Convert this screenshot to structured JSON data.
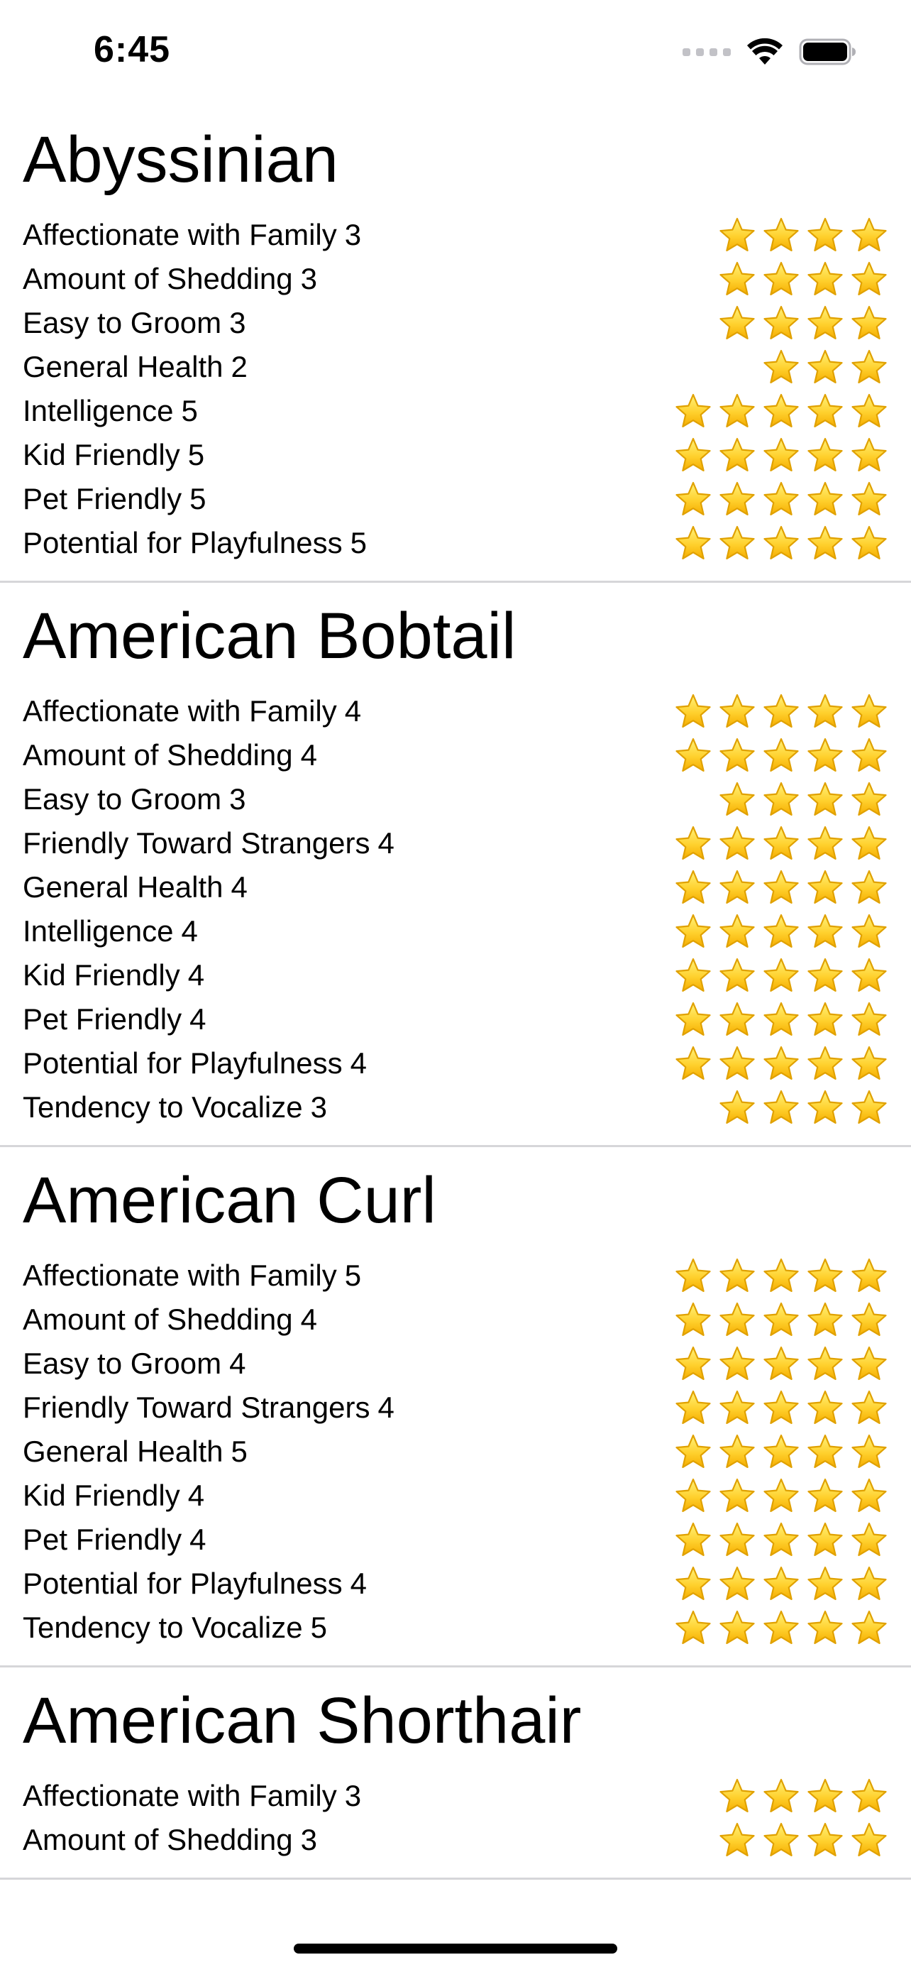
{
  "status_bar": {
    "time": "6:45"
  },
  "colors": {
    "star_fill": "#ffd12e",
    "star_stroke": "#e0a100",
    "separator": "#d6d6d9"
  },
  "icons": {
    "star": "star-icon",
    "wifi": "wifi-icon",
    "battery": "battery-icon",
    "signal": "signal-icon"
  },
  "breeds": [
    {
      "name": "Abyssinian",
      "ratings": [
        {
          "label": "Affectionate with Family",
          "value": 3,
          "stars": 4
        },
        {
          "label": "Amount of Shedding",
          "value": 3,
          "stars": 4
        },
        {
          "label": "Easy to Groom",
          "value": 3,
          "stars": 4
        },
        {
          "label": "General Health",
          "value": 2,
          "stars": 3
        },
        {
          "label": "Intelligence",
          "value": 5,
          "stars": 5
        },
        {
          "label": "Kid Friendly",
          "value": 5,
          "stars": 5
        },
        {
          "label": "Pet Friendly",
          "value": 5,
          "stars": 5
        },
        {
          "label": "Potential for Playfulness",
          "value": 5,
          "stars": 5
        }
      ]
    },
    {
      "name": "American Bobtail",
      "ratings": [
        {
          "label": "Affectionate with Family",
          "value": 4,
          "stars": 5
        },
        {
          "label": "Amount of Shedding",
          "value": 4,
          "stars": 5
        },
        {
          "label": "Easy to Groom",
          "value": 3,
          "stars": 4
        },
        {
          "label": "Friendly Toward Strangers",
          "value": 4,
          "stars": 5
        },
        {
          "label": "General Health",
          "value": 4,
          "stars": 5
        },
        {
          "label": "Intelligence",
          "value": 4,
          "stars": 5
        },
        {
          "label": "Kid Friendly",
          "value": 4,
          "stars": 5
        },
        {
          "label": "Pet Friendly",
          "value": 4,
          "stars": 5
        },
        {
          "label": "Potential for Playfulness",
          "value": 4,
          "stars": 5
        },
        {
          "label": "Tendency to Vocalize",
          "value": 3,
          "stars": 4
        }
      ]
    },
    {
      "name": "American Curl",
      "ratings": [
        {
          "label": "Affectionate with Family",
          "value": 5,
          "stars": 5
        },
        {
          "label": "Amount of Shedding",
          "value": 4,
          "stars": 5
        },
        {
          "label": "Easy to Groom",
          "value": 4,
          "stars": 5
        },
        {
          "label": "Friendly Toward Strangers",
          "value": 4,
          "stars": 5
        },
        {
          "label": "General Health",
          "value": 5,
          "stars": 5
        },
        {
          "label": "Kid Friendly",
          "value": 4,
          "stars": 5
        },
        {
          "label": "Pet Friendly",
          "value": 4,
          "stars": 5
        },
        {
          "label": "Potential for Playfulness",
          "value": 4,
          "stars": 5
        },
        {
          "label": "Tendency to Vocalize",
          "value": 5,
          "stars": 5
        }
      ]
    },
    {
      "name": "American Shorthair",
      "ratings": [
        {
          "label": "Affectionate with Family",
          "value": 3,
          "stars": 4
        },
        {
          "label": "Amount of Shedding",
          "value": 3,
          "stars": 4
        }
      ]
    }
  ]
}
